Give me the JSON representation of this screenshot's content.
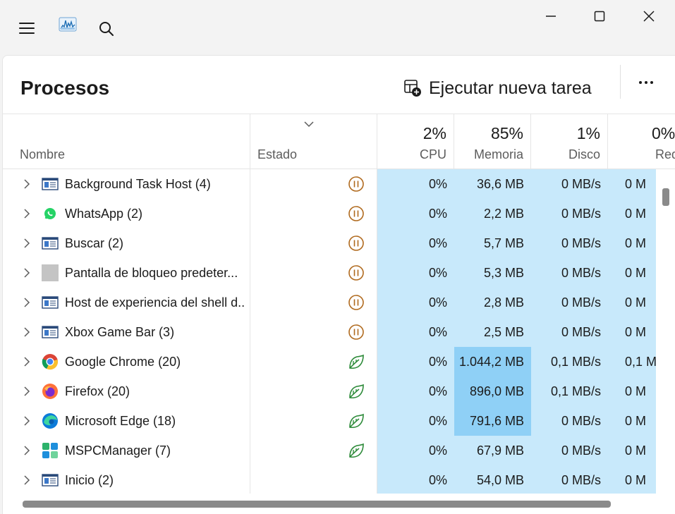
{
  "window": {
    "app_icon": "performance-graph-icon",
    "controls": [
      "minimize-icon",
      "maximize-icon",
      "close-icon"
    ]
  },
  "page": {
    "title": "Procesos",
    "run_task_label": "Ejecutar nueva tarea"
  },
  "columns": {
    "name": "Nombre",
    "status": "Estado",
    "cpu": {
      "pct": "2%",
      "label": "CPU"
    },
    "memory": {
      "pct": "85%",
      "label": "Memoria"
    },
    "disk": {
      "pct": "1%",
      "label": "Disco"
    },
    "network": {
      "pct": "0%",
      "label": "Red"
    }
  },
  "colors": {
    "cell_bg": "#c8e9fb",
    "cell_highlight": "#8fd0f6",
    "suspended": "#b06a1e",
    "efficiency": "#2e8b3a"
  },
  "rows": [
    {
      "name": "Background Task Host (4)",
      "icon": "app-window-icon",
      "status": "suspended",
      "cpu": "0%",
      "memory": "36,6 MB",
      "disk": "0 MB/s",
      "network": "0 M",
      "mem_high": false
    },
    {
      "name": "WhatsApp (2)",
      "icon": "whatsapp-icon",
      "status": "suspended",
      "cpu": "0%",
      "memory": "2,2 MB",
      "disk": "0 MB/s",
      "network": "0 M",
      "mem_high": false
    },
    {
      "name": "Buscar (2)",
      "icon": "app-window-icon",
      "status": "suspended",
      "cpu": "0%",
      "memory": "5,7 MB",
      "disk": "0 MB/s",
      "network": "0 M",
      "mem_high": false
    },
    {
      "name": "Pantalla de bloqueo predeter...",
      "icon": "gray-square-icon",
      "status": "suspended",
      "cpu": "0%",
      "memory": "5,3 MB",
      "disk": "0 MB/s",
      "network": "0 M",
      "mem_high": false
    },
    {
      "name": "Host de experiencia del shell d...",
      "icon": "app-window-icon",
      "status": "suspended",
      "cpu": "0%",
      "memory": "2,8 MB",
      "disk": "0 MB/s",
      "network": "0 M",
      "mem_high": false
    },
    {
      "name": "Xbox Game Bar (3)",
      "icon": "app-window-icon",
      "status": "suspended",
      "cpu": "0%",
      "memory": "2,5 MB",
      "disk": "0 MB/s",
      "network": "0 M",
      "mem_high": false
    },
    {
      "name": "Google Chrome (20)",
      "icon": "chrome-icon",
      "status": "efficiency",
      "cpu": "0%",
      "memory": "1.044,2 MB",
      "disk": "0,1 MB/s",
      "network": "0,1 M",
      "mem_high": true
    },
    {
      "name": "Firefox (20)",
      "icon": "firefox-icon",
      "status": "efficiency",
      "cpu": "0%",
      "memory": "896,0 MB",
      "disk": "0,1 MB/s",
      "network": "0 M",
      "mem_high": true
    },
    {
      "name": "Microsoft Edge (18)",
      "icon": "edge-icon",
      "status": "efficiency",
      "cpu": "0%",
      "memory": "791,6 MB",
      "disk": "0 MB/s",
      "network": "0 M",
      "mem_high": true
    },
    {
      "name": "MSPCManager (7)",
      "icon": "mspcmanager-icon",
      "status": "efficiency",
      "cpu": "0%",
      "memory": "67,9 MB",
      "disk": "0 MB/s",
      "network": "0 M",
      "mem_high": false
    },
    {
      "name": "Inicio (2)",
      "icon": "app-window-icon",
      "status": "",
      "cpu": "0%",
      "memory": "54,0 MB",
      "disk": "0 MB/s",
      "network": "0 M",
      "mem_high": false
    }
  ]
}
